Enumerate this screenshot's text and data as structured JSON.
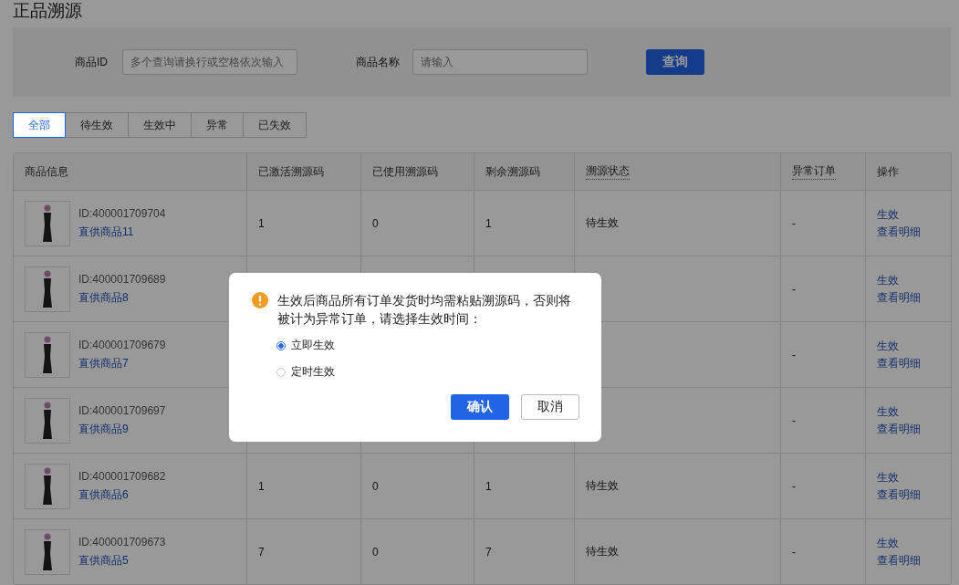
{
  "page_title": "正品溯源",
  "filters": [
    {
      "label": "商品ID",
      "placeholder": "多个查询请换行或空格依次输入"
    },
    {
      "label": "商品名称",
      "placeholder": "请输入"
    }
  ],
  "query_button": "查询",
  "tabs": [
    {
      "label": "全部",
      "selected": true
    },
    {
      "label": "待生效",
      "selected": false
    },
    {
      "label": "生效中",
      "selected": false
    },
    {
      "label": "异常",
      "selected": false
    },
    {
      "label": "已失效",
      "selected": false
    }
  ],
  "table": {
    "columns": [
      {
        "label": "商品信息",
        "hint": false
      },
      {
        "label": "已激活溯源码",
        "hint": false
      },
      {
        "label": "已使用溯源码",
        "hint": false
      },
      {
        "label": "剩余溯源码",
        "hint": false
      },
      {
        "label": "溯源状态",
        "hint": true
      },
      {
        "label": "异常订单",
        "hint": true
      },
      {
        "label": "操作",
        "hint": false
      }
    ],
    "rows": [
      {
        "id": "ID:400001709704",
        "name": "直供商品11",
        "activated": "1",
        "used": "0",
        "remaining": "1",
        "status": "待生效",
        "abnormal": "-",
        "actions": [
          "生效",
          "查看明细"
        ]
      },
      {
        "id": "ID:400001709689",
        "name": "直供商品8",
        "abnormal": "-",
        "actions": [
          "生效",
          "查看明细"
        ]
      },
      {
        "id": "ID:400001709679",
        "name": "直供商品7",
        "abnormal": "-",
        "actions": [
          "生效",
          "查看明细"
        ]
      },
      {
        "id": "ID:400001709697",
        "name": "直供商品9",
        "abnormal": "-",
        "actions": [
          "生效",
          "查看明细"
        ]
      },
      {
        "id": "ID:400001709682",
        "name": "直供商品6",
        "activated": "1",
        "used": "0",
        "remaining": "1",
        "status": "待生效",
        "abnormal": "-",
        "actions": [
          "生效",
          "查看明细"
        ]
      },
      {
        "id": "ID:400001709673",
        "name": "直供商品5",
        "activated": "7",
        "used": "0",
        "remaining": "7",
        "status": "待生效",
        "abnormal": "-",
        "actions": [
          "生效",
          "查看明细"
        ]
      }
    ]
  },
  "dialog": {
    "message": "生效后商品所有订单发货时均需粘贴溯源码，否则将被计为异常订单，请选择生效时间：",
    "options": [
      {
        "label": "立即生效",
        "selected": true
      },
      {
        "label": "定时生效",
        "selected": false
      }
    ],
    "confirm": "确认",
    "cancel": "取消"
  }
}
